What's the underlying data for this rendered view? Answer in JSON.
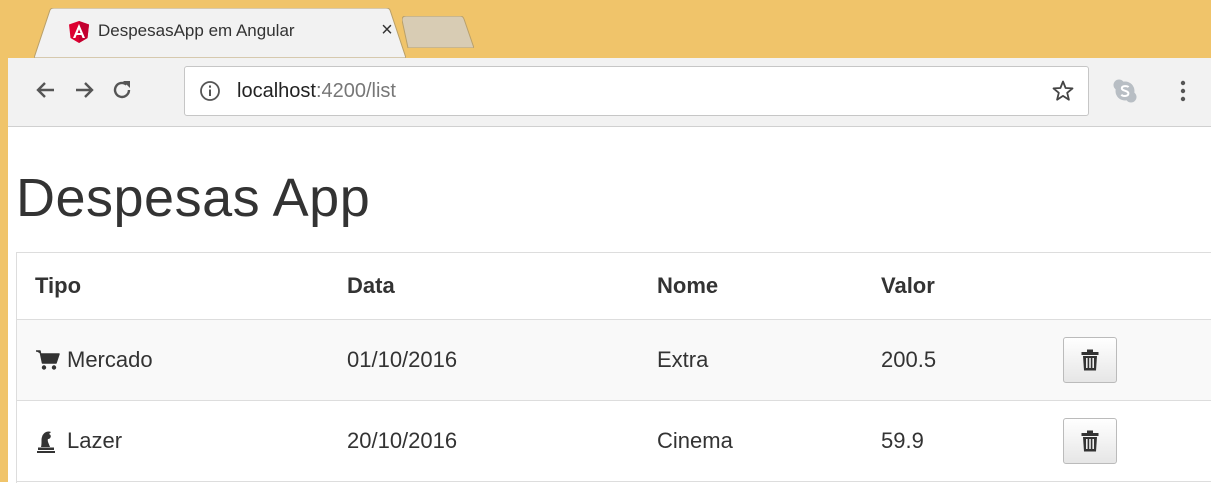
{
  "browser": {
    "tab_title": "DespesasApp em Angular",
    "tab_close": "×",
    "url_host": "localhost",
    "url_rest": ":4200/list",
    "favicon": "angular-icon",
    "icons": [
      "back-arrow-icon",
      "forward-arrow-icon",
      "reload-icon",
      "info-icon",
      "star-icon",
      "skype-icon",
      "more-menu-icon"
    ]
  },
  "page": {
    "title": "Despesas App"
  },
  "table": {
    "headers": [
      "Tipo",
      "Data",
      "Nome",
      "Valor"
    ],
    "rows": [
      {
        "tipo": "Mercado",
        "tipo_icon": "shopping-cart-icon",
        "data": "01/10/2016",
        "nome": "Extra",
        "valor": "200.5"
      },
      {
        "tipo": "Lazer",
        "tipo_icon": "chess-piece-icon",
        "data": "20/10/2016",
        "nome": "Cinema",
        "valor": "59.9"
      }
    ],
    "delete_icon": "trash-icon"
  },
  "colors": {
    "frame": "#f0c46a",
    "toolbar": "#f2f2f2",
    "text": "#333333",
    "row_stripe": "#f9f9f9",
    "border": "#dddddd"
  }
}
